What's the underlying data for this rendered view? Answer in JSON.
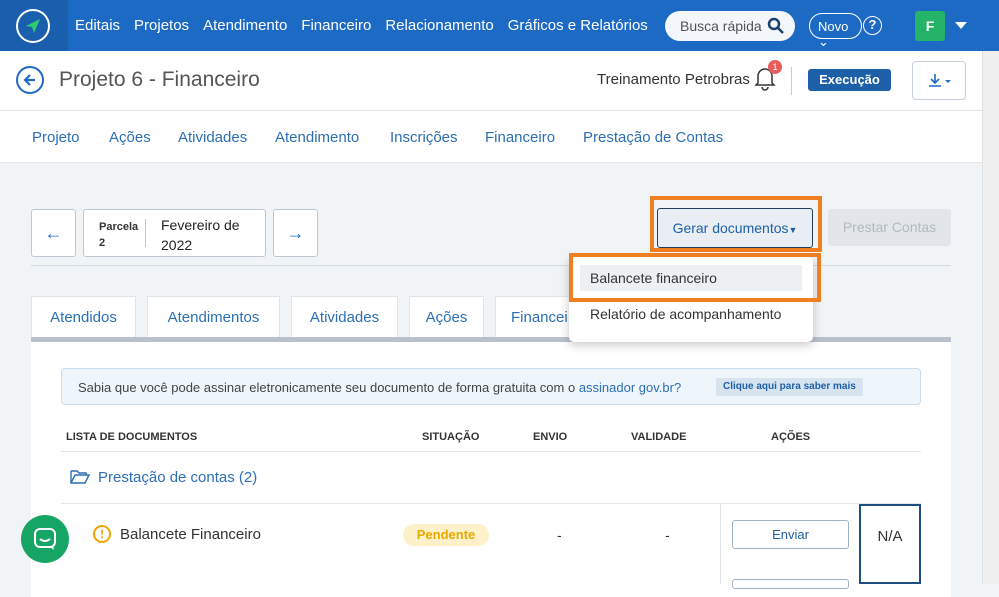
{
  "nav": {
    "links": [
      "Editais",
      "Projetos",
      "Atendimento",
      "Financeiro",
      "Relacionamento",
      "Gráficos e Relatórios"
    ],
    "search_placeholder": "Busca rápida",
    "novo_label": "Novo",
    "help_label": "?",
    "avatar_letter": "F"
  },
  "header": {
    "title": "Projeto 6 - Financeiro",
    "program": "Treinamento Petrobras",
    "notification_count": "1",
    "status": "Execução"
  },
  "subtabs": [
    "Projeto",
    "Ações",
    "Atividades",
    "Atendimento",
    "Inscrições",
    "Financeiro",
    "Prestação de Contas"
  ],
  "parcel": {
    "label_line1": "Parcela",
    "label_line2": "2",
    "value": "Fevereiro de 2022",
    "prev_icon": "←",
    "next_icon": "→"
  },
  "actions": {
    "gerar_label": "Gerar documentos",
    "prestar_label": "Prestar Contas"
  },
  "dropdown": {
    "items": [
      "Balancete financeiro",
      "Relatório de acompanhamento"
    ]
  },
  "content_tabs": [
    "Atendidos",
    "Atendimentos",
    "Atividades",
    "Ações",
    "Financei"
  ],
  "banner": {
    "text": "Sabia que você pode assinar eletronicamente seu documento de forma gratuita com o ",
    "link": "assinador gov.br?",
    "chip": "Clique aqui para saber mais"
  },
  "table": {
    "headers": [
      "LISTA DE DOCUMENTOS",
      "SITUAÇÃO",
      "ENVIO",
      "VALIDADE",
      "AÇÕES"
    ],
    "folder": "Prestação de contas (2)",
    "row": {
      "name": "Balancete Financeiro",
      "status": "Pendente",
      "envio": "-",
      "validade": "-",
      "action": "Enviar",
      "extra": "N/A"
    }
  },
  "colors": {
    "primary": "#1d6ac4",
    "highlight": "#f07f22",
    "pending_bg": "#fdf1c9",
    "chat": "#17a566"
  }
}
